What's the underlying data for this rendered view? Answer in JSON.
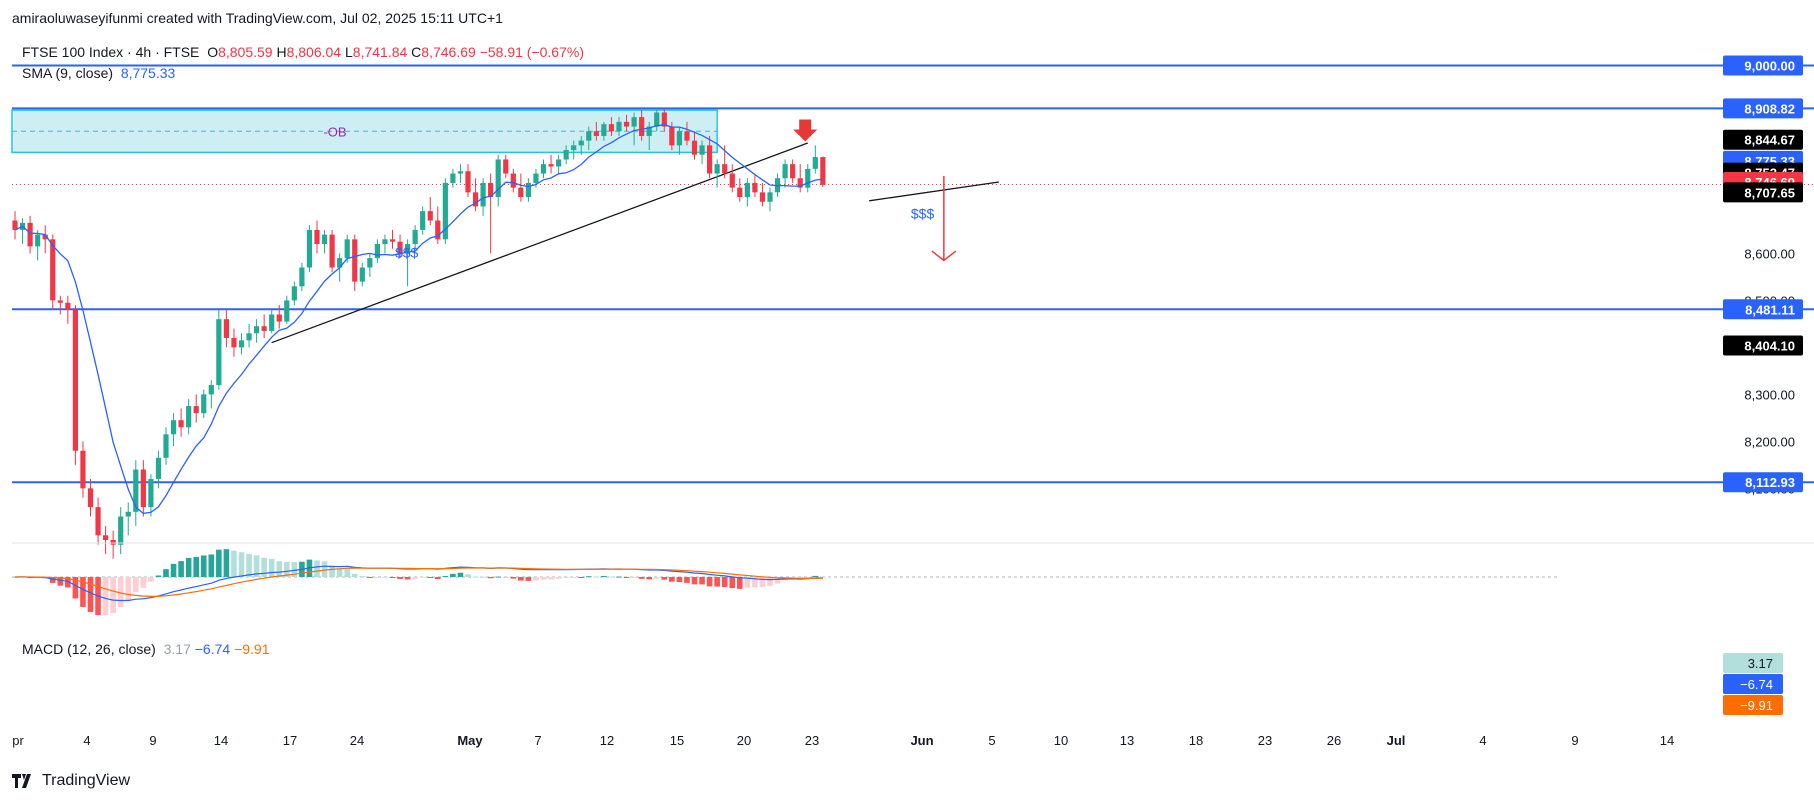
{
  "header": {
    "credit": "amiraoluwaseyifunmi created with TradingView.com, Jul 02, 2025 15:11 UTC+1"
  },
  "legend": {
    "symbol": "FTSE 100 Index · 4h · FTSE",
    "o_label": "O",
    "o_value": "8,805.59",
    "h_label": "H",
    "h_value": "8,806.04",
    "l_label": "L",
    "l_value": "8,741.84",
    "c_label": "C",
    "c_value": "8,746.69",
    "change": "−58.91 (−0.67%)",
    "sma_label": "SMA (9, close)",
    "sma_value": "8,775.33",
    "macd_label": "MACD (12, 26, close)",
    "macd_hist": "3.17",
    "macd_line": "−6.74",
    "macd_signal": "−9.91"
  },
  "brand": {
    "name": "TradingView"
  },
  "colors": {
    "up": "#22ab94",
    "down": "#f23645",
    "sma": "#2962ff",
    "level": "#2962ff",
    "ob_fill": "#cdeff3",
    "ob_stroke": "#26c6da",
    "macd_line": "#2962ff",
    "signal_line": "#ff6d00"
  },
  "chart_data": {
    "type": "candlestick",
    "symbol": "FTSE 100 Index",
    "timeframe": "4h",
    "ylim": [
      7990,
      9050
    ],
    "x_tick_labels": [
      "pr",
      "4",
      "9",
      "14",
      "17",
      "24",
      "May",
      "7",
      "12",
      "15",
      "20",
      "23",
      "Jun",
      "5",
      "10",
      "13",
      "18",
      "23",
      "26",
      "Jul",
      "4",
      "9",
      "14"
    ],
    "y_axis_labels": [
      "8,600.00",
      "8,500.00",
      "8,300.00",
      "8,200.00",
      "8,100.00"
    ],
    "horizontal_levels": [
      {
        "value": 9000.0,
        "label": "9,000.00"
      },
      {
        "value": 8908.82,
        "label": "8,908.82"
      },
      {
        "value": 8481.11,
        "label": "8,481.11"
      },
      {
        "value": 8112.93,
        "label": "8,112.93"
      }
    ],
    "price_tags": [
      {
        "value": 8844.67,
        "label": "8,844.67",
        "color": "#000000"
      },
      {
        "value": 8775.33,
        "label": "8,775.33",
        "color": "#2962ff"
      },
      {
        "value": 8752.47,
        "label": "8,752.47",
        "color": "#000000"
      },
      {
        "value": 8746.69,
        "label": "8,746.69",
        "color": "#f23645"
      },
      {
        "value": 8707.65,
        "label": "8,707.65",
        "color": "#000000"
      },
      {
        "value": 8404.1,
        "label": "8,404.10",
        "color": "#000000"
      }
    ],
    "order_block": {
      "label": "OB",
      "top": 8905,
      "bottom": 8815,
      "mid": 8860
    },
    "annotations": [
      {
        "text": "$$$",
        "near": "mid uptrend line"
      },
      {
        "text": "$$$",
        "near": "late-June low"
      }
    ],
    "current_price": 8746.69,
    "macd_tags": [
      {
        "label": "3.17",
        "color": "#b2dfdb"
      },
      {
        "label": "−6.74",
        "color": "#2962ff"
      },
      {
        "label": "−9.91",
        "color": "#ff6d00"
      }
    ],
    "candles": [
      [
        8670,
        8690,
        8630,
        8650
      ],
      [
        8650,
        8675,
        8620,
        8665
      ],
      [
        8665,
        8680,
        8600,
        8615
      ],
      [
        8615,
        8650,
        8585,
        8640
      ],
      [
        8640,
        8660,
        8600,
        8630
      ],
      [
        8630,
        8640,
        8480,
        8500
      ],
      [
        8500,
        8510,
        8470,
        8495
      ],
      [
        8495,
        8510,
        8450,
        8480
      ],
      [
        8480,
        8490,
        8150,
        8180
      ],
      [
        8180,
        8200,
        8080,
        8100
      ],
      [
        8100,
        8120,
        8040,
        8060
      ],
      [
        8060,
        8080,
        7980,
        8000
      ],
      [
        8000,
        8020,
        7960,
        7990
      ],
      [
        7990,
        8010,
        7950,
        7980
      ],
      [
        7980,
        8060,
        7960,
        8040
      ],
      [
        8040,
        8070,
        8000,
        8050
      ],
      [
        8050,
        8160,
        8020,
        8140
      ],
      [
        8140,
        8160,
        8040,
        8060
      ],
      [
        8060,
        8130,
        8040,
        8120
      ],
      [
        8120,
        8180,
        8100,
        8165
      ],
      [
        8165,
        8230,
        8150,
        8215
      ],
      [
        8215,
        8260,
        8190,
        8245
      ],
      [
        8245,
        8270,
        8210,
        8230
      ],
      [
        8230,
        8290,
        8215,
        8275
      ],
      [
        8275,
        8300,
        8240,
        8260
      ],
      [
        8260,
        8310,
        8250,
        8300
      ],
      [
        8300,
        8330,
        8270,
        8320
      ],
      [
        8320,
        8480,
        8310,
        8460
      ],
      [
        8460,
        8480,
        8400,
        8420
      ],
      [
        8420,
        8440,
        8380,
        8400
      ],
      [
        8400,
        8430,
        8385,
        8415
      ],
      [
        8415,
        8450,
        8400,
        8430
      ],
      [
        8430,
        8460,
        8410,
        8445
      ],
      [
        8445,
        8470,
        8420,
        8435
      ],
      [
        8435,
        8480,
        8430,
        8470
      ],
      [
        8470,
        8490,
        8440,
        8455
      ],
      [
        8455,
        8510,
        8450,
        8500
      ],
      [
        8500,
        8540,
        8490,
        8530
      ],
      [
        8530,
        8580,
        8520,
        8570
      ],
      [
        8570,
        8660,
        8560,
        8650
      ],
      [
        8650,
        8670,
        8600,
        8620
      ],
      [
        8620,
        8650,
        8600,
        8640
      ],
      [
        8640,
        8650,
        8560,
        8570
      ],
      [
        8570,
        8600,
        8540,
        8590
      ],
      [
        8590,
        8640,
        8580,
        8630
      ],
      [
        8630,
        8640,
        8520,
        8540
      ],
      [
        8540,
        8580,
        8530,
        8570
      ],
      [
        8570,
        8600,
        8550,
        8590
      ],
      [
        8590,
        8630,
        8580,
        8620
      ],
      [
        8620,
        8640,
        8600,
        8630
      ],
      [
        8630,
        8650,
        8610,
        8625
      ],
      [
        8625,
        8640,
        8590,
        8600
      ],
      [
        8600,
        8630,
        8530,
        8620
      ],
      [
        8620,
        8660,
        8610,
        8650
      ],
      [
        8650,
        8700,
        8640,
        8690
      ],
      [
        8690,
        8720,
        8660,
        8670
      ],
      [
        8670,
        8700,
        8620,
        8630
      ],
      [
        8630,
        8760,
        8620,
        8750
      ],
      [
        8750,
        8780,
        8740,
        8770
      ],
      [
        8770,
        8790,
        8750,
        8775
      ],
      [
        8775,
        8790,
        8720,
        8730
      ],
      [
        8730,
        8760,
        8690,
        8700
      ],
      [
        8700,
        8760,
        8680,
        8750
      ],
      [
        8750,
        8770,
        8600,
        8720
      ],
      [
        8720,
        8810,
        8700,
        8800
      ],
      [
        8800,
        8810,
        8760,
        8770
      ],
      [
        8770,
        8780,
        8730,
        8740
      ],
      [
        8740,
        8770,
        8710,
        8720
      ],
      [
        8720,
        8760,
        8710,
        8750
      ],
      [
        8750,
        8780,
        8740,
        8770
      ],
      [
        8770,
        8800,
        8760,
        8790
      ],
      [
        8790,
        8810,
        8770,
        8785
      ],
      [
        8785,
        8810,
        8770,
        8800
      ],
      [
        8800,
        8830,
        8790,
        8820
      ],
      [
        8820,
        8840,
        8800,
        8830
      ],
      [
        8830,
        8850,
        8810,
        8840
      ],
      [
        8840,
        8870,
        8820,
        8860
      ],
      [
        8860,
        8880,
        8840,
        8850
      ],
      [
        8850,
        8880,
        8840,
        8875
      ],
      [
        8875,
        8890,
        8850,
        8860
      ],
      [
        8860,
        8890,
        8850,
        8880
      ],
      [
        8880,
        8895,
        8860,
        8870
      ],
      [
        8870,
        8900,
        8830,
        8890
      ],
      [
        8890,
        8905,
        8840,
        8850
      ],
      [
        8850,
        8880,
        8820,
        8870
      ],
      [
        8870,
        8908,
        8860,
        8900
      ],
      [
        8900,
        8908,
        8860,
        8870
      ],
      [
        8870,
        8880,
        8820,
        8830
      ],
      [
        8830,
        8870,
        8810,
        8860
      ],
      [
        8860,
        8880,
        8830,
        8840
      ],
      [
        8840,
        8860,
        8800,
        8810
      ],
      [
        8810,
        8840,
        8790,
        8830
      ],
      [
        8830,
        8850,
        8760,
        8770
      ],
      [
        8770,
        8800,
        8740,
        8790
      ],
      [
        8790,
        8830,
        8760,
        8770
      ],
      [
        8770,
        8790,
        8730,
        8740
      ],
      [
        8740,
        8760,
        8710,
        8720
      ],
      [
        8720,
        8760,
        8700,
        8750
      ],
      [
        8750,
        8770,
        8720,
        8730
      ],
      [
        8730,
        8750,
        8700,
        8710
      ],
      [
        8710,
        8740,
        8690,
        8730
      ],
      [
        8730,
        8770,
        8720,
        8760
      ],
      [
        8760,
        8800,
        8740,
        8790
      ],
      [
        8790,
        8800,
        8750,
        8760
      ],
      [
        8760,
        8790,
        8730,
        8740
      ],
      [
        8740,
        8790,
        8730,
        8780
      ],
      [
        8780,
        8830,
        8770,
        8805
      ],
      [
        8805,
        8806,
        8741,
        8746
      ]
    ]
  }
}
